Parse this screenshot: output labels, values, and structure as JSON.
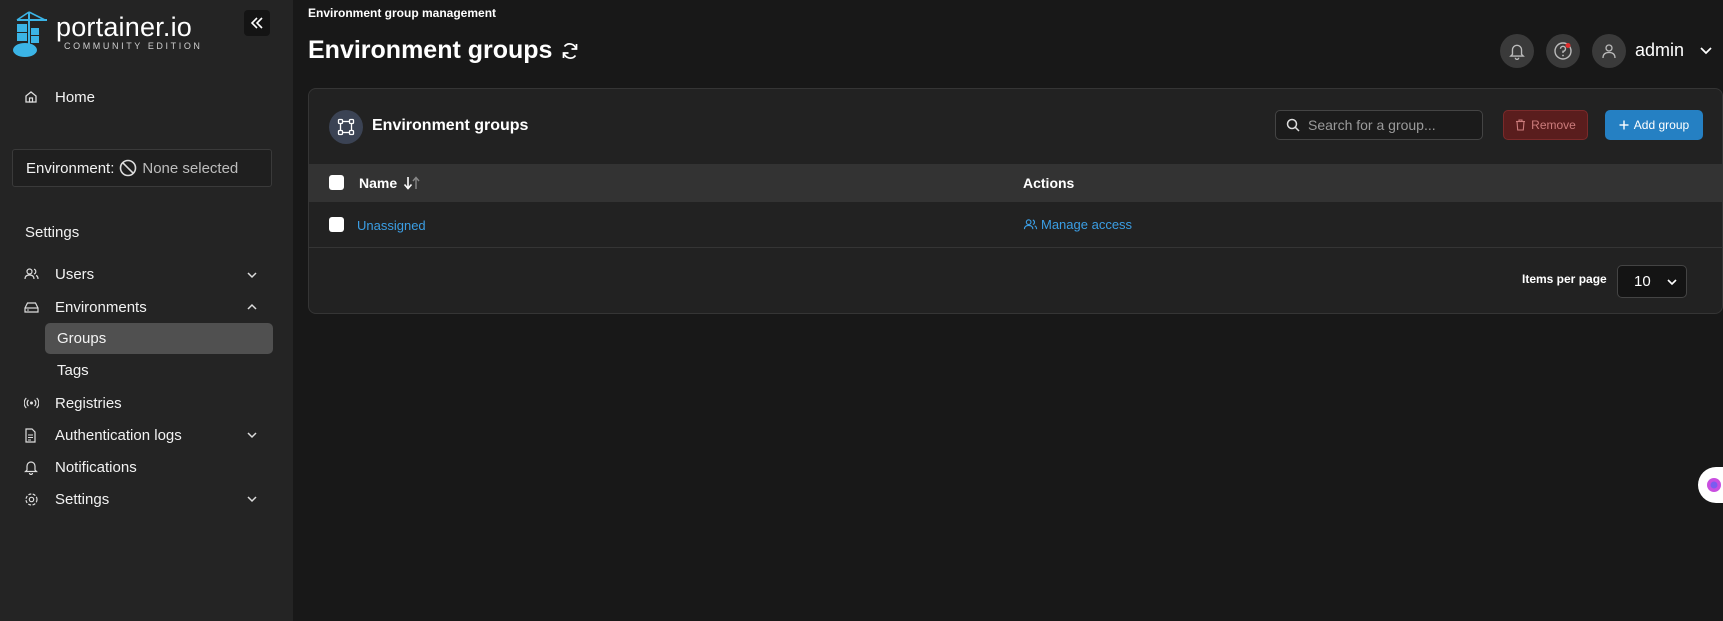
{
  "brand": {
    "name": "portainer.io",
    "edition": "COMMUNITY EDITION"
  },
  "sidebar": {
    "home_label": "Home",
    "environment_label": "Environment:",
    "environment_value": "None selected",
    "section_title": "Settings",
    "items": [
      {
        "label": "Users",
        "icon": "users-icon",
        "chevron": "down"
      },
      {
        "label": "Environments",
        "icon": "hard-drive-icon",
        "chevron": "up"
      },
      {
        "label": "Registries",
        "icon": "radio-icon"
      },
      {
        "label": "Authentication logs",
        "icon": "file-text-icon",
        "chevron": "down"
      },
      {
        "label": "Notifications",
        "icon": "bell-icon"
      },
      {
        "label": "Settings",
        "icon": "gear-icon",
        "chevron": "down"
      }
    ],
    "subitems": [
      {
        "label": "Groups",
        "active": true
      },
      {
        "label": "Tags",
        "active": false
      }
    ]
  },
  "header": {
    "breadcrumb": "Environment group management",
    "title": "Environment groups",
    "user": "admin"
  },
  "card": {
    "title": "Environment groups",
    "search_placeholder": "Search for a group...",
    "remove_label": "Remove",
    "add_label": "Add group",
    "columns": [
      "Name",
      "Actions"
    ],
    "rows": [
      {
        "name": "Unassigned",
        "action": "Manage access"
      }
    ],
    "items_per_page_label": "Items per page",
    "items_per_page_value": "10"
  },
  "colors": {
    "accent": "#2580c3",
    "link": "#3b9ee4",
    "danger": "#5a1d1d",
    "sidebar_bg": "#242424",
    "page_bg": "#181818"
  }
}
